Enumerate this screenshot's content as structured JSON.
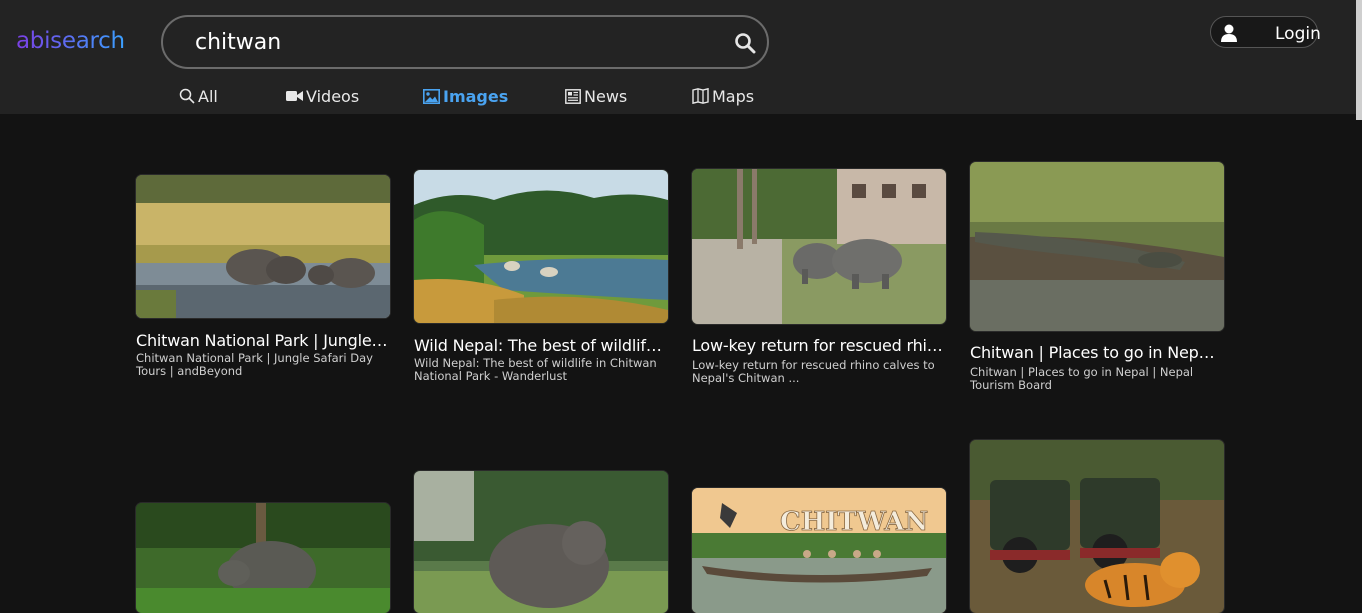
{
  "logo": "abisearch",
  "search": {
    "query": "chitwan"
  },
  "login_label": "Login",
  "tabs": [
    {
      "label": "All",
      "icon": "search-icon"
    },
    {
      "label": "Videos",
      "icon": "video-camera-icon"
    },
    {
      "label": "Images",
      "icon": "image-icon",
      "active": true
    },
    {
      "label": "News",
      "icon": "newspaper-icon"
    },
    {
      "label": "Maps",
      "icon": "map-icon"
    }
  ],
  "results": [
    {
      "title": "Chitwan National Park | Jungle…",
      "subtitle": "Chitwan National Park | Jungle Safari Day Tours | andBeyond",
      "image": "elephants-in-river"
    },
    {
      "title": "Wild Nepal: The best of wildlife i…",
      "subtitle": "Wild Nepal: The best of wildlife in Chitwan National Park - Wanderlust",
      "image": "river-forest-landscape"
    },
    {
      "title": "Low-key return for rescued rhino…",
      "subtitle": "Low-key return for rescued rhino calves to Nepal's Chitwan ...",
      "image": "rhino-calves"
    },
    {
      "title": "Chitwan | Places to go in Nepal |…",
      "subtitle": "Chitwan | Places to go in Nepal | Nepal Tourism Board",
      "image": "crocodile"
    },
    {
      "title": "",
      "subtitle": "",
      "image": "rhino-in-grass"
    },
    {
      "title": "",
      "subtitle": "",
      "image": "elephant-walking"
    },
    {
      "title": "",
      "subtitle": "",
      "image": "chitwan-canoe",
      "sign_text": "CHITWAN"
    },
    {
      "title": "",
      "subtitle": "",
      "image": "jeep-safari-tiger"
    }
  ],
  "colors": {
    "accent": "#4aa3f0",
    "header_bg": "#232323",
    "page_bg": "#131313"
  }
}
